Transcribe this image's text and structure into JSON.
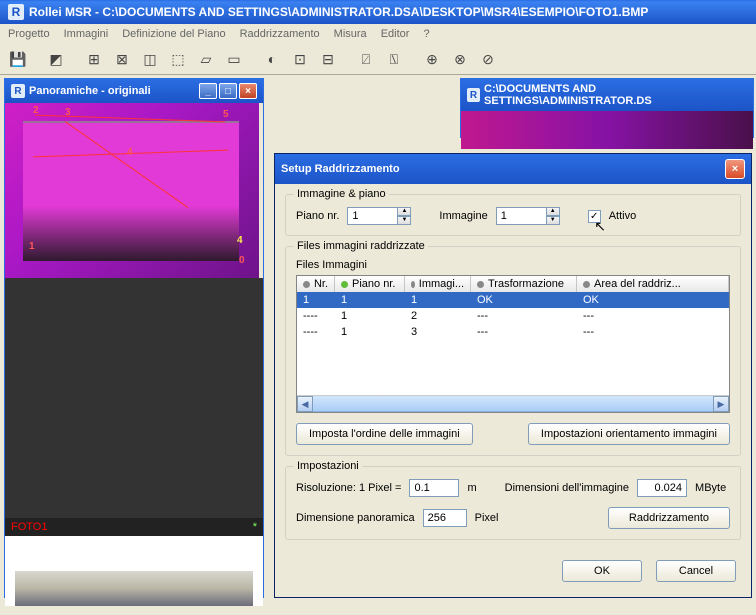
{
  "titlebar": {
    "app": "Rollei MSR",
    "path": "C:\\DOCUMENTS AND SETTINGS\\ADMINISTRATOR.DSA\\DESKTOP\\MSR4\\ESEMPIO\\FOTO1.BMP"
  },
  "menu": {
    "progetto": "Progetto",
    "immagini": "Immagini",
    "definizione": "Definizione del Piano",
    "raddrizzamento": "Raddrizzamento",
    "misura": "Misura",
    "editor": "Editor",
    "help": "?"
  },
  "panels": {
    "panoramiche_title": "Panoramiche - originali",
    "second_title": "C:\\DOCUMENTS AND SETTINGS\\ADMINISTRATOR.DS",
    "foto_label": "FOTO1",
    "foto_star": "*"
  },
  "dialog": {
    "title": "Setup Raddrizzamento",
    "fs1": {
      "legend": "Immagine & piano",
      "piano_lbl": "Piano nr.",
      "piano_val": "1",
      "immagine_lbl": "Immagine",
      "immagine_val": "1",
      "attivo_lbl": "Attivo",
      "attivo_checked": "✓"
    },
    "fs2": {
      "legend": "Files immagini raddrizzate",
      "sublabel": "Files Immagini",
      "cols": {
        "nr": "Nr.",
        "piano": "Piano nr.",
        "immagi": "Immagi...",
        "trasf": "Trasformazione",
        "area": "Area del raddriz..."
      },
      "rows": [
        {
          "nr": "1",
          "piano": "1",
          "imm": "1",
          "tras": "OK",
          "area": "OK"
        },
        {
          "nr": "----",
          "piano": "1",
          "imm": "2",
          "tras": "---",
          "area": "---"
        },
        {
          "nr": "----",
          "piano": "1",
          "imm": "3",
          "tras": "---",
          "area": "---"
        }
      ],
      "btn_ordine": "Imposta l'ordine delle immagini",
      "btn_orient": "Impostazioni orientamento immagini"
    },
    "fs3": {
      "legend": "Impostazioni",
      "risoluzione_lbl": "Risoluzione: 1 Pixel =",
      "risoluzione_val": "0.1",
      "risoluzione_unit": "m",
      "dim_lbl": "Dimensioni dell'immagine",
      "dim_val": "0.024",
      "dim_unit": "MByte",
      "pan_lbl": "Dimensione panoramica",
      "pan_val": "256",
      "pan_unit": "Pixel",
      "btn_radd": "Raddrizzamento"
    },
    "ok": "OK",
    "cancel": "Cancel"
  }
}
